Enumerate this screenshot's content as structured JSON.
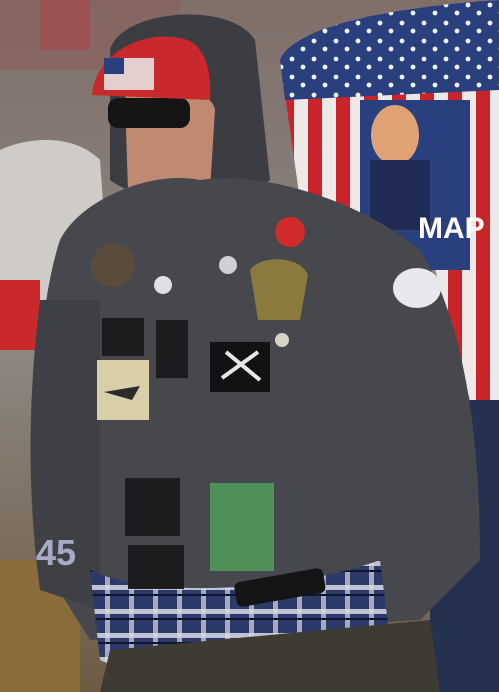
{
  "photo": {
    "flag_jacket_text": "MAP",
    "sleeve_number": "45"
  },
  "colors": {
    "jacket": "#47484d",
    "jacket_dark": "#2f3034",
    "hood": "#3c3d42",
    "beanie": "#c9282c",
    "skin": "#c08a72",
    "flag_red": "#c8242a",
    "flag_blue": "#2a3f7e",
    "flannel_blue": "#2c3a6a",
    "flannel_white": "#d9dbe4",
    "patch_green": "#4f8f5a",
    "crowd_bg": "#9a8e85"
  }
}
